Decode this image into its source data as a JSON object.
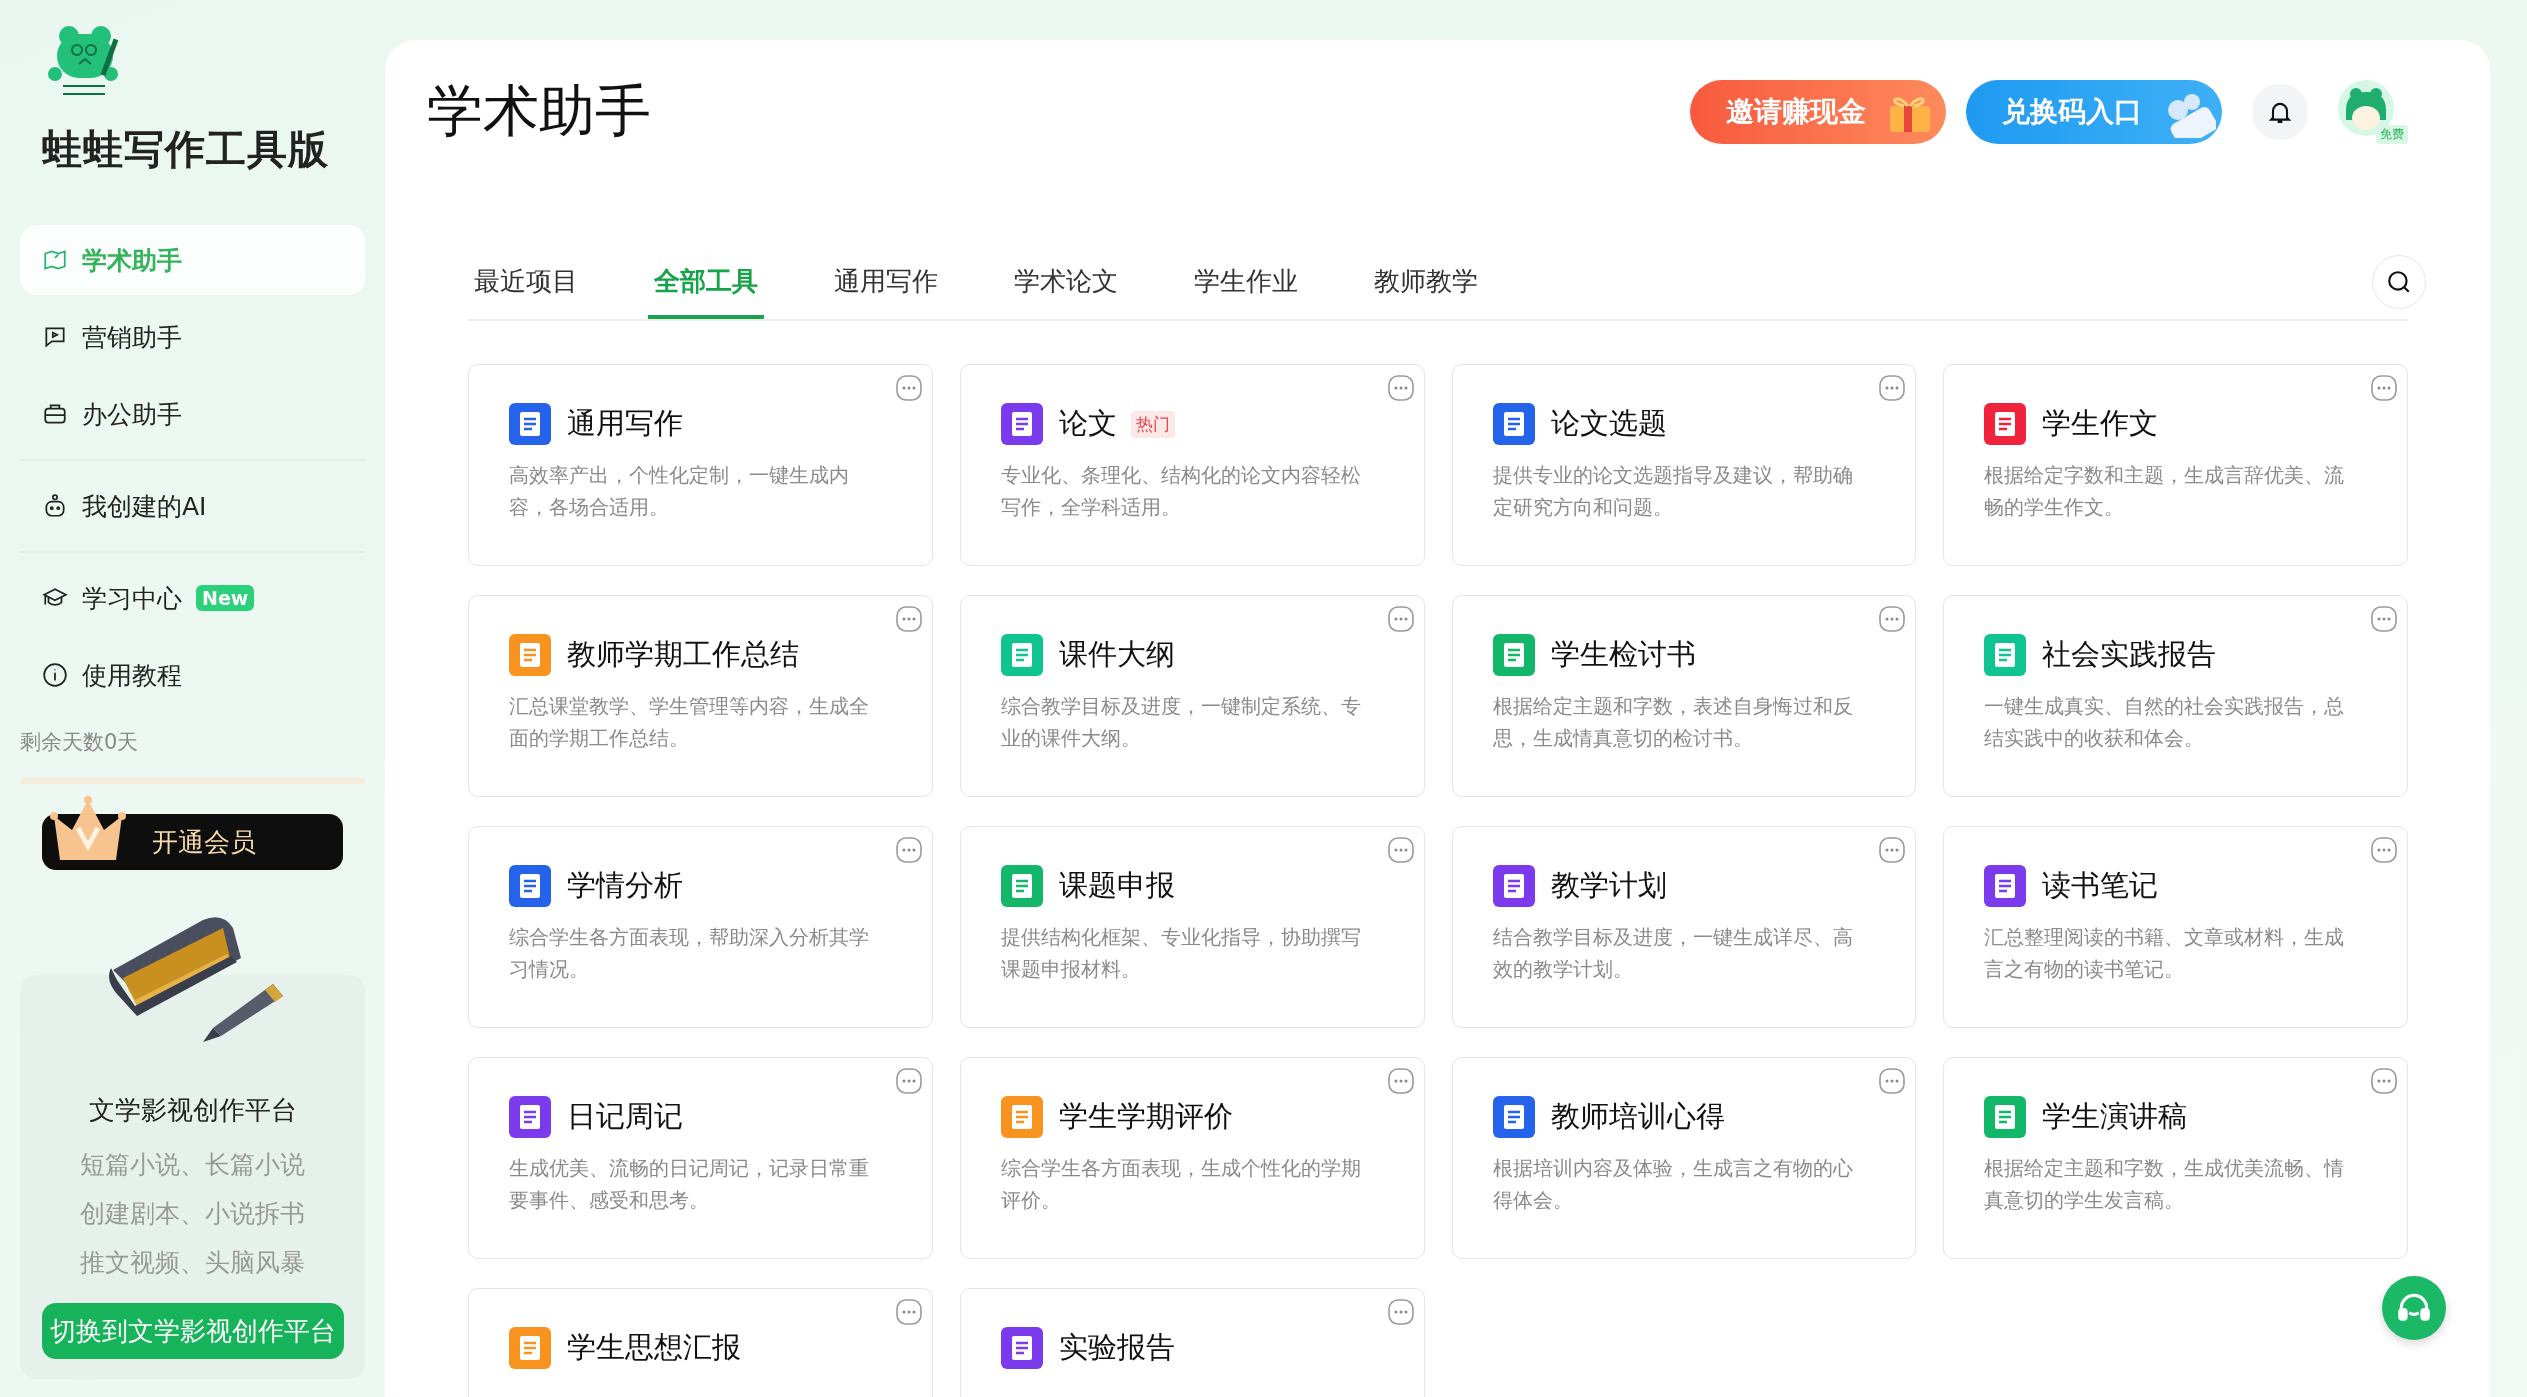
{
  "sidebar": {
    "brand": "蛙蛙写作工具版",
    "nav": [
      {
        "label": "学术助手",
        "selected": true
      },
      {
        "label": "营销助手",
        "selected": false
      },
      {
        "label": "办公助手",
        "selected": false
      },
      {
        "label": "我创建的AI",
        "selected": false
      },
      {
        "label": "学习中心",
        "selected": false,
        "badge": "New"
      },
      {
        "label": "使用教程",
        "selected": false
      }
    ],
    "remaining": "剩余天数0天",
    "vip_button": "开通会员",
    "promo": {
      "title": "文学影视创作平台",
      "lines": [
        "短篇小说、长篇小说",
        "创建剧本、小说拆书",
        "推文视频、头脑风暴"
      ],
      "button": "切换到文学影视创作平台"
    }
  },
  "header": {
    "title": "学术助手",
    "invite_button": "邀请赚现金",
    "redeem_button": "兑换码入口",
    "avatar_badge": "免费"
  },
  "tabs": [
    {
      "label": "最近项目",
      "selected": false
    },
    {
      "label": "全部工具",
      "selected": true
    },
    {
      "label": "通用写作",
      "selected": false
    },
    {
      "label": "学术论文",
      "selected": false
    },
    {
      "label": "学生作业",
      "selected": false
    },
    {
      "label": "教师教学",
      "selected": false
    }
  ],
  "cards": [
    {
      "title": "通用写作",
      "description": "高效率产出，个性化定制，一键生成内容，各场合适用。",
      "color": "#2563eb"
    },
    {
      "title": "论文",
      "tag": "热门",
      "description": "专业化、条理化、结构化的论文内容轻松写作，全学科适用。",
      "color": "#7c3aed"
    },
    {
      "title": "论文选题",
      "description": "提供专业的论文选题指导及建议，帮助确定研究方向和问题。",
      "color": "#2563eb"
    },
    {
      "title": "学生作文",
      "description": "根据给定字数和主题，生成言辞优美、流畅的学生作文。",
      "color": "#ef233c"
    },
    {
      "title": "教师学期工作总结",
      "description": "汇总课堂教学、学生管理等内容，生成全面的学期工作总结。",
      "color": "#f7931e"
    },
    {
      "title": "课件大纲",
      "description": "综合教学目标及进度，一键制定系统、专业的课件大纲。",
      "color": "#10c490"
    },
    {
      "title": "学生检讨书",
      "description": "根据给定主题和字数，表述自身悔过和反思，生成情真意切的检讨书。",
      "color": "#12b76a"
    },
    {
      "title": "社会实践报告",
      "description": "一键生成真实、自然的社会实践报告，总结实践中的收获和体会。",
      "color": "#10c491"
    },
    {
      "title": "学情分析",
      "description": "综合学生各方面表现，帮助深入分析其学习情况。",
      "color": "#2563eb"
    },
    {
      "title": "课题申报",
      "description": "提供结构化框架、专业化指导，协助撰写课题申报材料。",
      "color": "#12b76a"
    },
    {
      "title": "教学计划",
      "description": "结合教学目标及进度，一键生成详尽、高效的教学计划。",
      "color": "#7c3aed"
    },
    {
      "title": "读书笔记",
      "description": "汇总整理阅读的书籍、文章或材料，生成言之有物的读书笔记。",
      "color": "#7c3aed"
    },
    {
      "title": "日记周记",
      "description": "生成优美、流畅的日记周记，记录日常重要事件、感受和思考。",
      "color": "#7c3aed"
    },
    {
      "title": "学生学期评价",
      "description": "综合学生各方面表现，生成个性化的学期评价。",
      "color": "#f7931e"
    },
    {
      "title": "教师培训心得",
      "description": "根据培训内容及体验，生成言之有物的心得体会。",
      "color": "#2563eb"
    },
    {
      "title": "学生演讲稿",
      "description": "根据给定主题和字数，生成优美流畅、情真意切的学生发言稿。",
      "color": "#12b76a"
    },
    {
      "title": "学生思想汇报",
      "color": "#f7931e"
    },
    {
      "title": "实验报告",
      "color": "#7c3aed"
    }
  ]
}
